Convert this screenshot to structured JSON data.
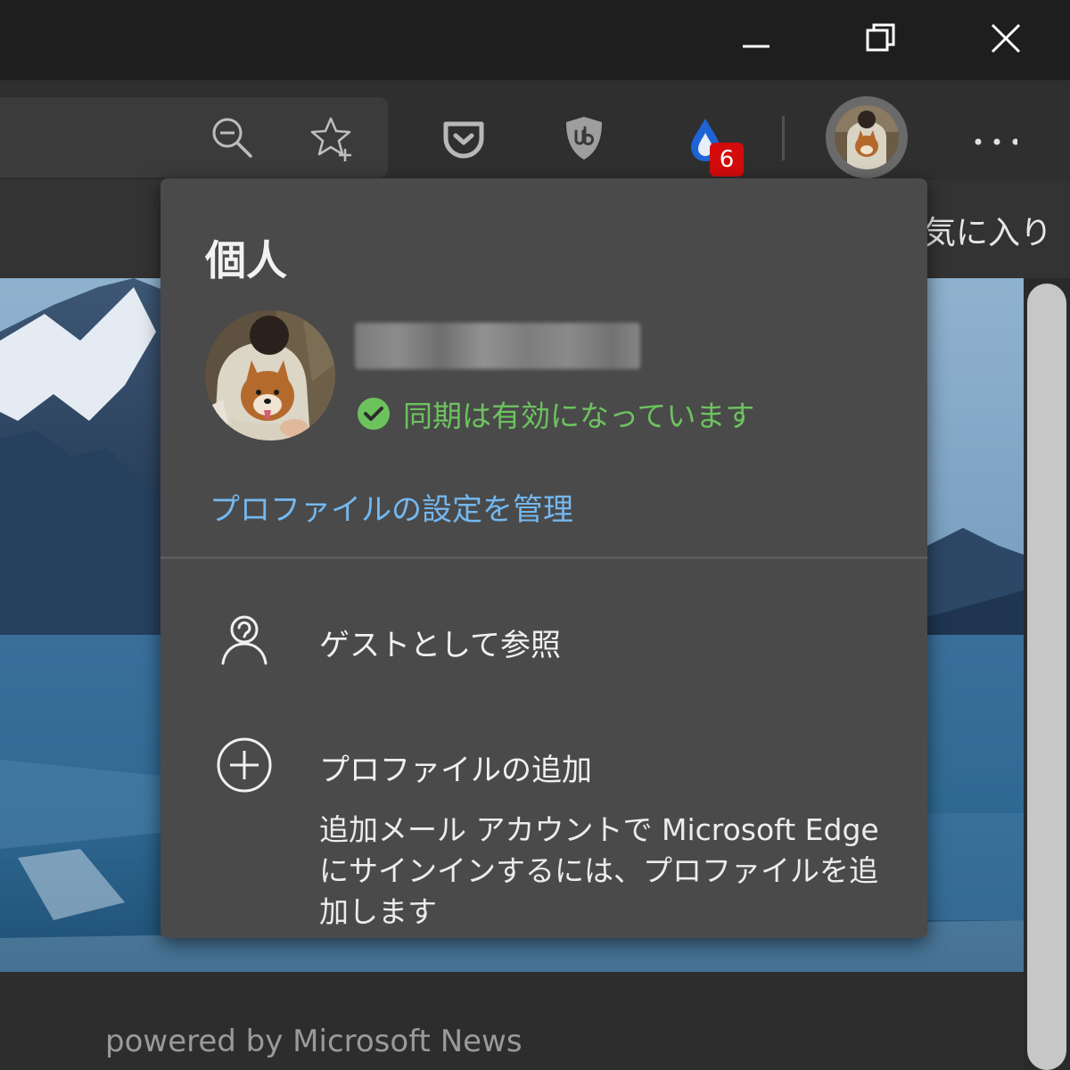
{
  "window": {
    "controls": [
      {
        "icon": "minimize-icon"
      },
      {
        "icon": "restore-icon"
      },
      {
        "icon": "close-icon"
      }
    ]
  },
  "toolbar": {
    "icons": [
      "zoom-out-icon",
      "add-favorite-icon",
      "pocket-extension-icon",
      "ublock-origin-icon",
      "raindrop-extension-icon",
      "profile-avatar-icon",
      "more-icon"
    ],
    "extension_badge": "6"
  },
  "favorites_bar": {
    "partial_text": "気に入り"
  },
  "footer": {
    "powered_by": "powered by Microsoft News"
  },
  "profile_popup": {
    "title": "個人",
    "sync_status": "同期は有効になっています",
    "manage_link": "プロファイルの設定を管理",
    "menu": [
      {
        "label": "ゲストとして参照",
        "icon": "guest-person-icon"
      },
      {
        "label": "プロファイルの追加",
        "icon": "add-circle-icon"
      }
    ],
    "add_profile_description": "追加メール アカウントで Microsoft Edge にサインインするには、プロファイルを追加します"
  },
  "colors": {
    "sync_green": "#6cc35e",
    "link_blue": "#74b8f0",
    "badge_red": "#d40b0b",
    "popup_bg": "#4a4a4a"
  }
}
